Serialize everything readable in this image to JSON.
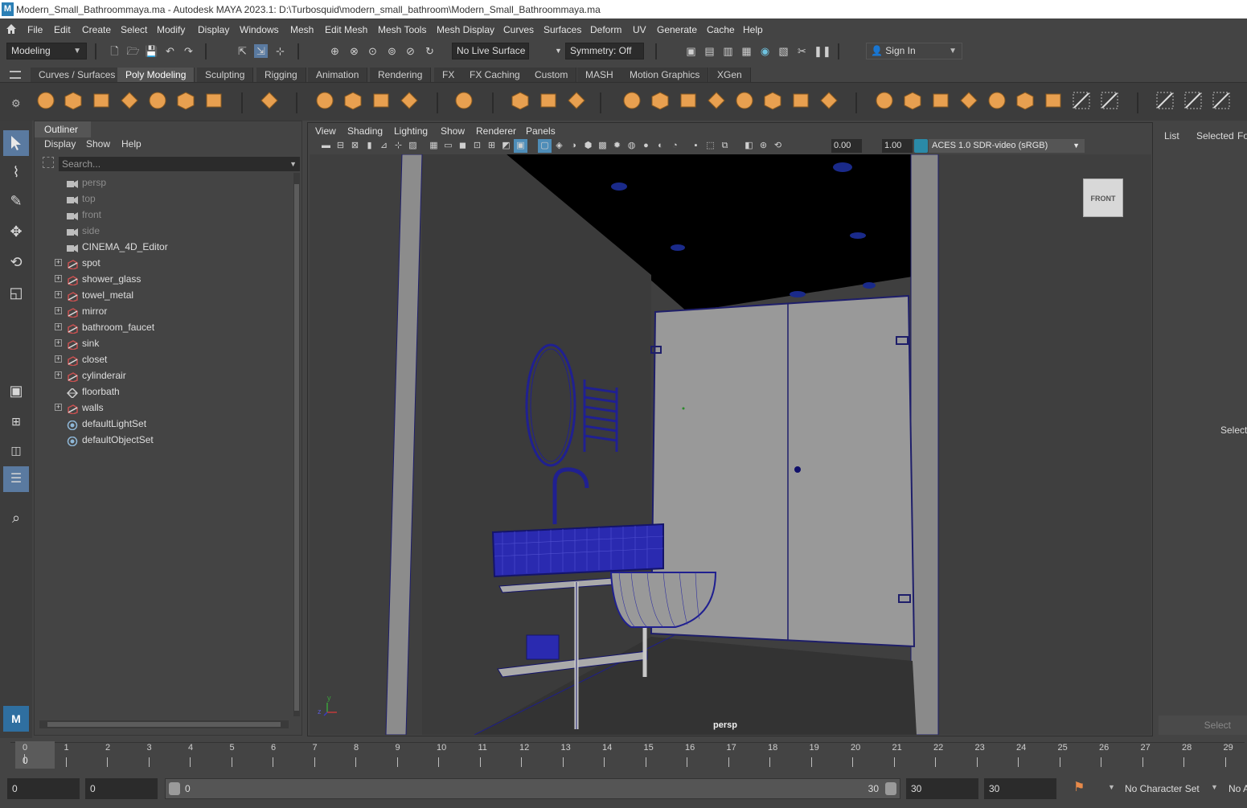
{
  "window": {
    "title": "Modern_Small_Bathroommaya.ma - Autodesk MAYA 2023.1: D:\\Turbosquid\\modern_small_bathroom\\Modern_Small_Bathroommaya.ma",
    "logo_letter": "M"
  },
  "menubar": {
    "items": [
      "File",
      "Edit",
      "Create",
      "Select",
      "Modify",
      "Display",
      "Windows",
      "Mesh",
      "Edit Mesh",
      "Mesh Tools",
      "Mesh Display",
      "Curves",
      "Surfaces",
      "Deform",
      "UV",
      "Generate",
      "Cache",
      "Help"
    ]
  },
  "statusline": {
    "menuset": "Modeling",
    "live_surface": "No Live Surface",
    "symmetry": "Symmetry: Off",
    "sign_in": "Sign In"
  },
  "shelf": {
    "tabs": [
      "Curves / Surfaces",
      "Poly Modeling",
      "Sculpting",
      "Rigging",
      "Animation",
      "Rendering",
      "FX",
      "FX Caching",
      "Custom",
      "MASH",
      "Motion Graphics",
      "XGen"
    ],
    "active_tab": "Poly Modeling",
    "accent": "#e8a050"
  },
  "outliner": {
    "title": "Outliner",
    "menu": [
      "Display",
      "Show",
      "Help"
    ],
    "search_placeholder": "Search...",
    "items": [
      {
        "label": "persp",
        "type": "camera",
        "dim": true,
        "expandable": false
      },
      {
        "label": "top",
        "type": "camera",
        "dim": true,
        "expandable": false
      },
      {
        "label": "front",
        "type": "camera",
        "dim": true,
        "expandable": false
      },
      {
        "label": "side",
        "type": "camera",
        "dim": true,
        "expandable": false
      },
      {
        "label": "CINEMA_4D_Editor",
        "type": "camera",
        "dim": false,
        "expandable": false
      },
      {
        "label": "spot",
        "type": "group",
        "dim": false,
        "expandable": true
      },
      {
        "label": "shower_glass",
        "type": "group",
        "dim": false,
        "expandable": true
      },
      {
        "label": "towel_metal",
        "type": "group",
        "dim": false,
        "expandable": true
      },
      {
        "label": "mirror",
        "type": "group",
        "dim": false,
        "expandable": true
      },
      {
        "label": "bathroom_faucet",
        "type": "group",
        "dim": false,
        "expandable": true
      },
      {
        "label": "sink",
        "type": "group",
        "dim": false,
        "expandable": true
      },
      {
        "label": "closet",
        "type": "group",
        "dim": false,
        "expandable": true
      },
      {
        "label": "cylinderair",
        "type": "group",
        "dim": false,
        "expandable": true
      },
      {
        "label": "floorbath",
        "type": "mesh",
        "dim": false,
        "expandable": false
      },
      {
        "label": "walls",
        "type": "group",
        "dim": false,
        "expandable": true
      },
      {
        "label": "defaultLightSet",
        "type": "set",
        "dim": false,
        "expandable": false
      },
      {
        "label": "defaultObjectSet",
        "type": "set",
        "dim": false,
        "expandable": false
      }
    ]
  },
  "viewport": {
    "menu": [
      "View",
      "Shading",
      "Lighting",
      "Show",
      "Renderer",
      "Panels"
    ],
    "exposure": "0.00",
    "gamma": "1.00",
    "color_space": "ACES 1.0 SDR-video (sRGB)",
    "camera_label": "persp",
    "viewcube_label": "FRONT",
    "axis_y": "y",
    "axis_z": "z"
  },
  "channelbox": {
    "tabs": [
      "List",
      "Selected",
      "Fo"
    ],
    "center_text": "Select",
    "bottom_button": "Select"
  },
  "timeline": {
    "ticks": [
      "0",
      "1",
      "2",
      "3",
      "4",
      "5",
      "6",
      "7",
      "8",
      "9",
      "10",
      "11",
      "12",
      "13",
      "14",
      "15",
      "16",
      "17",
      "18",
      "19",
      "20",
      "21",
      "22",
      "23",
      "24",
      "25",
      "26",
      "27",
      "28",
      "29"
    ],
    "current_frame": "0"
  },
  "rangebar": {
    "start": "0",
    "playback_start": "0",
    "slider_start": "0",
    "slider_end": "30",
    "playback_end": "30",
    "end": "30",
    "character_set": "No Character Set",
    "anim_layer": "No A"
  }
}
